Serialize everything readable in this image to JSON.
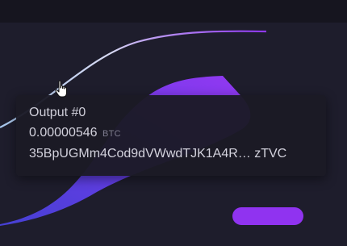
{
  "tooltip": {
    "title": "Output #0",
    "amount": "0.00000546",
    "unit": "BTC",
    "address": "35BpUGMm4Cod9dVWwdTJK1A4R… zTVC"
  },
  "icons": {
    "cursor": "hand-pointer-icon"
  },
  "colors": {
    "background": "#1e1d2c",
    "flow_start": "#4b43d6",
    "flow_end": "#8f39f0",
    "pill": "#9033f0",
    "line_start": "#a9c8ec",
    "line_end": "#8e36f0"
  }
}
